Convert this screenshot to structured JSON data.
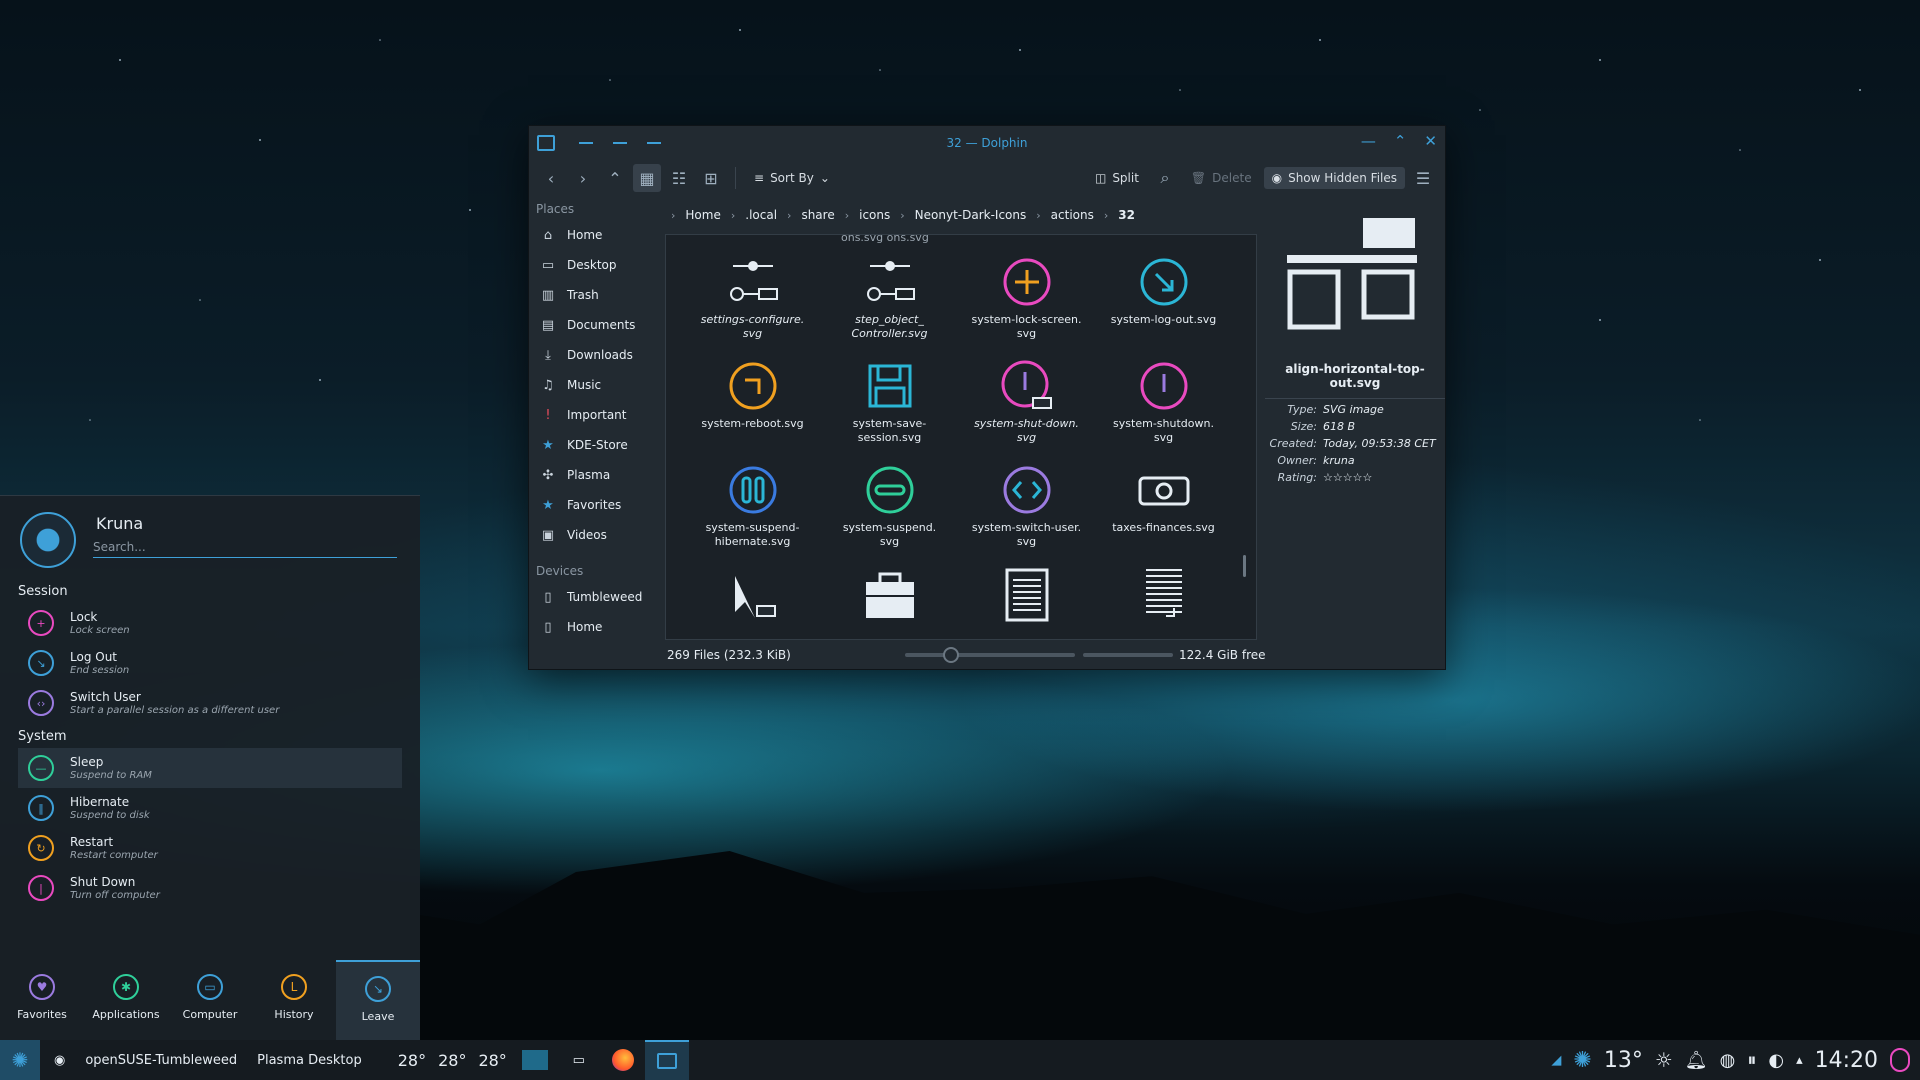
{
  "window": {
    "title": "32 — Dolphin",
    "toolbar": {
      "sort_label": "Sort By",
      "split_label": "Split",
      "delete_label": "Delete",
      "hidden_label": "Show Hidden Files"
    },
    "places_header": "Places",
    "places": [
      "Home",
      "Desktop",
      "Trash",
      "Documents",
      "Downloads",
      "Music",
      "Important",
      "KDE-Store",
      "Plasma",
      "Favorites",
      "Videos"
    ],
    "devices_header": "Devices",
    "devices": [
      "Tumbleweed",
      "Home"
    ],
    "breadcrumb": [
      "Home",
      ".local",
      "share",
      "icons",
      "Neonyt-Dark-Icons",
      "actions",
      "32"
    ],
    "top_cut_label": "ons.svg      ons.svg",
    "files": [
      {
        "name": "settings-configure.\nsvg",
        "icon": "slider-link-icon",
        "italic": true
      },
      {
        "name": "step_object_\nController.svg",
        "icon": "slider-link-icon",
        "italic": true
      },
      {
        "name": "system-lock-screen.\nsvg",
        "icon": "lock-plus-icon",
        "italic": false
      },
      {
        "name": "system-log-out.svg",
        "icon": "log-out-icon",
        "italic": false
      },
      {
        "name": "system-reboot.svg",
        "icon": "reboot-icon",
        "italic": false
      },
      {
        "name": "system-save-\nsession.svg",
        "icon": "floppy-icon",
        "italic": false
      },
      {
        "name": "system-shut-down.\nsvg",
        "icon": "shutdown-link-icon",
        "italic": true
      },
      {
        "name": "system-shutdown.\nsvg",
        "icon": "shutdown-icon",
        "italic": false
      },
      {
        "name": "system-suspend-\nhibernate.svg",
        "icon": "hibernate-icon",
        "italic": false
      },
      {
        "name": "system-suspend.\nsvg",
        "icon": "suspend-icon",
        "italic": false
      },
      {
        "name": "system-switch-user.\nsvg",
        "icon": "switch-user-icon",
        "italic": false
      },
      {
        "name": "taxes-finances.svg",
        "icon": "money-icon",
        "italic": false
      },
      {
        "name": "",
        "icon": "cursor-icon",
        "italic": false
      },
      {
        "name": "",
        "icon": "toolbox-icon",
        "italic": false
      },
      {
        "name": "",
        "icon": "document-icon",
        "italic": false
      },
      {
        "name": "",
        "icon": "document-lines-icon",
        "italic": false
      }
    ],
    "info": {
      "filename": "align-horizontal-top-out.svg",
      "type_key": "Type:",
      "type": "SVG image",
      "size_key": "Size:",
      "size": "618 B",
      "created_key": "Created:",
      "created": "Today, 09:53:38 CET",
      "owner_key": "Owner:",
      "owner": "kruna",
      "rating_key": "Rating:",
      "rating": "☆☆☆☆☆"
    },
    "status": {
      "count": "269 Files (232.3 KiB)",
      "free": "122.4 GiB free"
    }
  },
  "menu": {
    "user": "Kruna",
    "search_placeholder": "Search...",
    "session_header": "Session",
    "session": [
      {
        "label": "Lock",
        "desc": "Lock screen",
        "color": "#e94ac0",
        "glyph": "+"
      },
      {
        "label": "Log Out",
        "desc": "End session",
        "color": "#3ea0d8",
        "glyph": "↘"
      },
      {
        "label": "Switch User",
        "desc": "Start a parallel session as a different user",
        "color": "#9b7be0",
        "glyph": "‹›"
      }
    ],
    "system_header": "System",
    "system": [
      {
        "label": "Sleep",
        "desc": "Suspend to RAM",
        "color": "#2fcf9a",
        "glyph": "—"
      },
      {
        "label": "Hibernate",
        "desc": "Suspend to disk",
        "color": "#3ea0d8",
        "glyph": "‖"
      },
      {
        "label": "Restart",
        "desc": "Restart computer",
        "color": "#f0a020",
        "glyph": "↻"
      },
      {
        "label": "Shut Down",
        "desc": "Turn off computer",
        "color": "#e94ac0",
        "glyph": "|"
      }
    ],
    "tabs": [
      {
        "label": "Favorites",
        "color": "#9b7be0",
        "glyph": "♥"
      },
      {
        "label": "Applications",
        "color": "#2fcf9a",
        "glyph": "✱"
      },
      {
        "label": "Computer",
        "color": "#3ea0d8",
        "glyph": "▭"
      },
      {
        "label": "History",
        "color": "#f0a020",
        "glyph": "L"
      },
      {
        "label": "Leave",
        "color": "#3ea0d8",
        "glyph": "↘"
      }
    ]
  },
  "panel": {
    "distro": "openSUSE-Tumbleweed",
    "desktop": "Plasma Desktop",
    "temps": [
      "28°",
      "28°",
      "28°"
    ],
    "weather_temp": "13°",
    "clock": "14:20"
  }
}
